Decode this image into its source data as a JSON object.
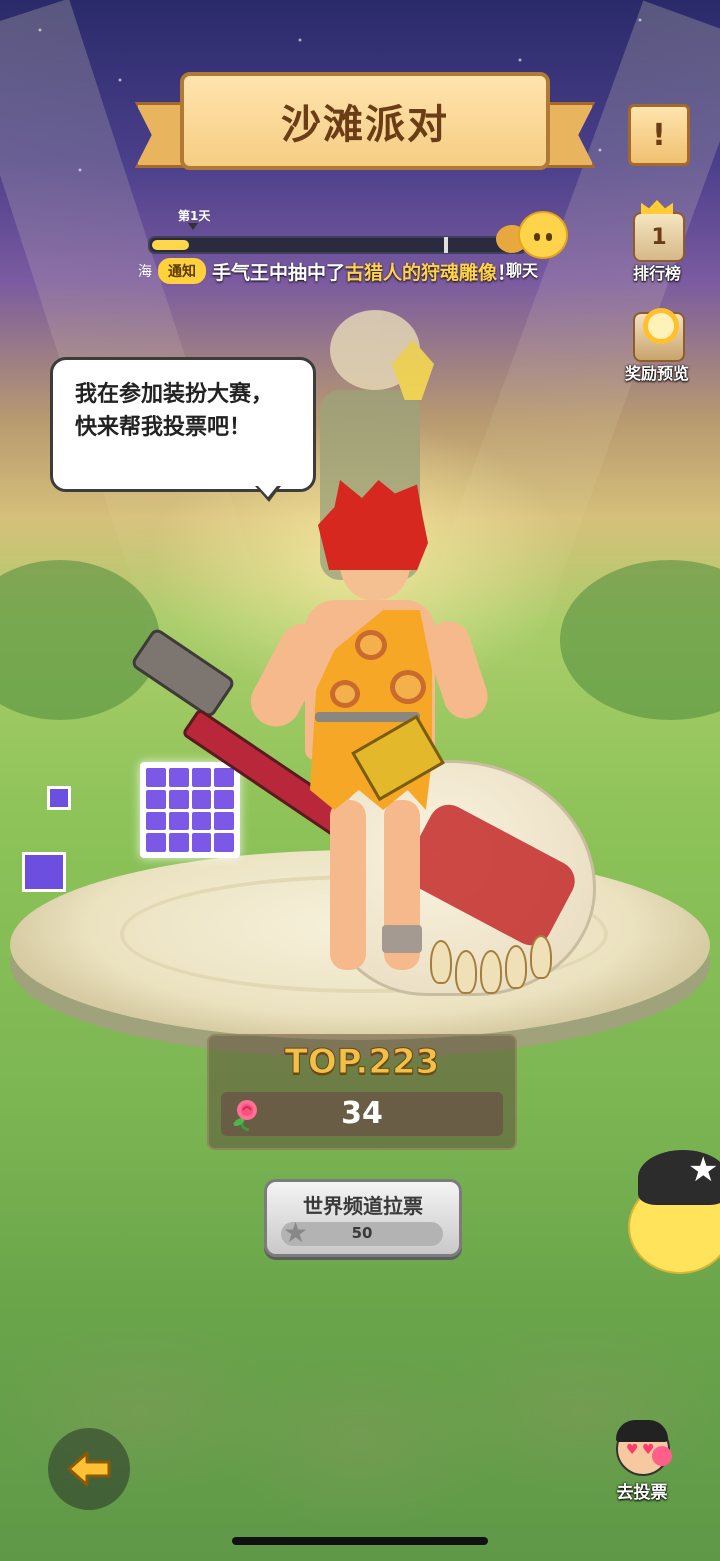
{
  "event": {
    "title": "沙滩派对",
    "day_label": "第1天",
    "progress_fraction": 0.1
  },
  "notice": {
    "prefix": "海",
    "badge": "通知",
    "text_before": "手气王中抽中了",
    "highlight": "古猎人的狩魂雕像",
    "text_after": "！"
  },
  "buttons": {
    "menu": "!",
    "chat": "聊天",
    "leaderboard": "排行榜",
    "leaderboard_icon_number": "1",
    "reward_preview": "奖励预览",
    "world_channel": "世界频道拉票",
    "world_channel_cost": "50",
    "go_vote": "去投票"
  },
  "speech": {
    "text": "我在参加装扮大赛，快来帮我投票吧！"
  },
  "contest": {
    "rank": "TOP.223",
    "votes": "34"
  },
  "icons": {
    "rose": "rose-icon",
    "star": "starfish-icon",
    "back": "back-arrow-icon"
  },
  "colors": {
    "accent_yellow": "#ffd24a",
    "banner": "#f6cd83",
    "grass": "#7cb653"
  }
}
